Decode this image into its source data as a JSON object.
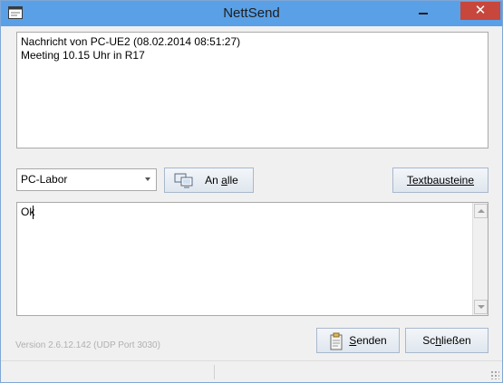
{
  "window": {
    "title": "NettSend",
    "close_glyph": "✕",
    "minimize_glyph": "—",
    "accent_color": "#5aa0e6",
    "close_color": "#c7473c"
  },
  "message_history": {
    "lines": [
      "Nachricht von PC-UE2 (08.02.2014 08:51:27)",
      "Meeting 10.15 Uhr in R17"
    ]
  },
  "recipient": {
    "selected": "PC-Labor"
  },
  "buttons": {
    "an_alle_prefix": "An ",
    "an_alle_underlined": "a",
    "an_alle_suffix": "lle",
    "textbausteine": "Textbausteine",
    "senden_underlined": "S",
    "senden_suffix": "enden",
    "schliessen_prefix": "Sc",
    "schliessen_underlined": "h",
    "schliessen_suffix": "ließen"
  },
  "input": {
    "value": "Ok"
  },
  "footer": {
    "version": "Version 2.6.12.142 (UDP Port 3030)"
  },
  "icons": {
    "app": "app-window-icon",
    "broadcast": "computers-icon",
    "send": "send-clipboard-icon",
    "select_arrow": "chevron-down-icon"
  }
}
